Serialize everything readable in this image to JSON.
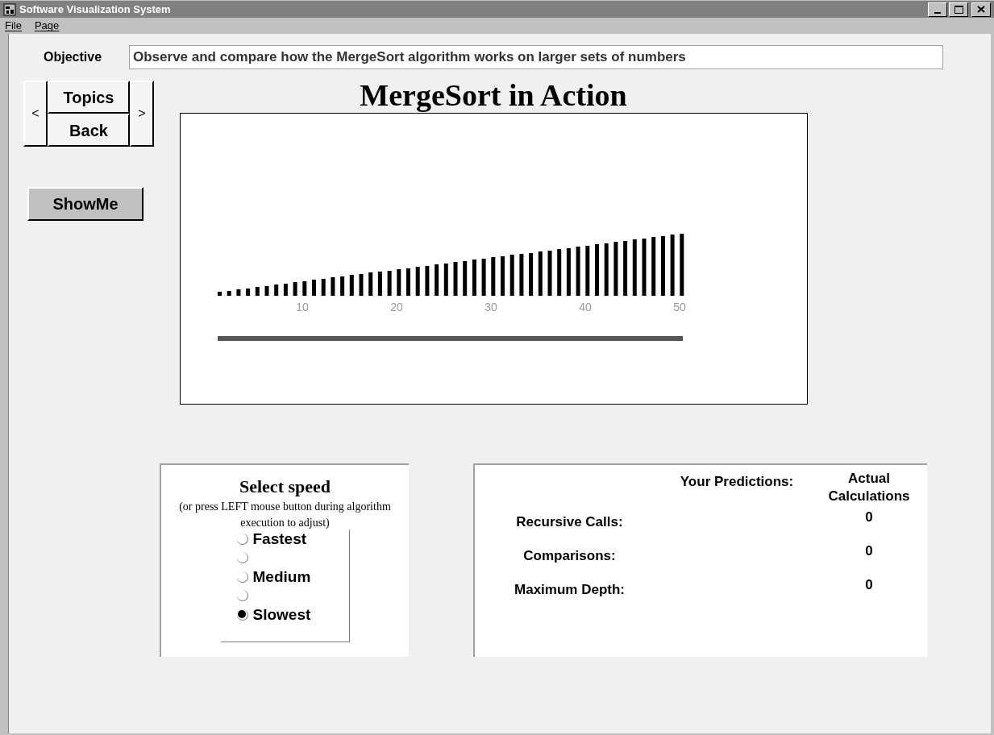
{
  "window": {
    "title": "Software Visualization System"
  },
  "menu": [
    "File",
    "Page"
  ],
  "objective": {
    "label": "Objective",
    "value": "Observe and compare how the MergeSort algorithm works on larger sets of numbers"
  },
  "nav": {
    "prev": "<",
    "topics": "Topics",
    "back": "Back",
    "next": ">"
  },
  "show_me": "ShowMe",
  "heading": "MergeSort in Action",
  "array_view": {
    "axis_labels": [
      "10",
      "20",
      "30",
      "40",
      "50"
    ]
  },
  "speed": {
    "title": "Select speed",
    "hint": "(or press LEFT mouse button during algorithm execution to adjust)",
    "options": [
      {
        "label": "Fastest",
        "selected": false
      },
      {
        "selected": false
      },
      {
        "label": "Medium",
        "selected": false
      },
      {
        "selected": false
      },
      {
        "label": "Slowest",
        "selected": true
      }
    ]
  },
  "stats": {
    "columns": [
      "Your Predictions:",
      "Actual Calculations"
    ],
    "rows": [
      {
        "label": "Recursive Calls:",
        "actual": "0"
      },
      {
        "label": "Comparisons:",
        "actual": "0"
      },
      {
        "label": "Maximum Depth:",
        "actual": "0"
      }
    ]
  }
}
